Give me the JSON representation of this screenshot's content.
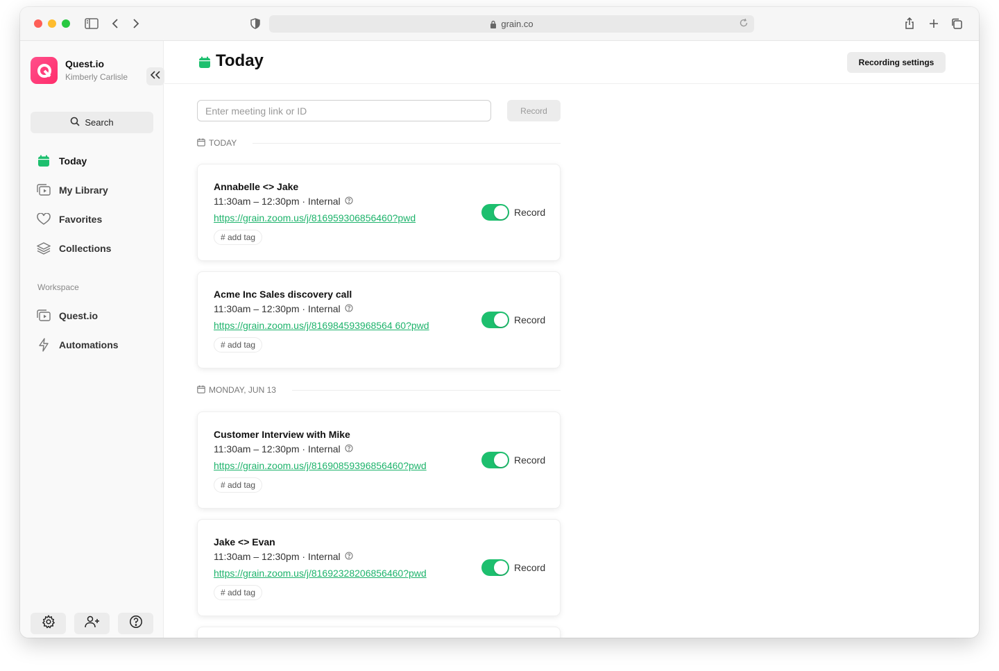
{
  "browser": {
    "url": "grain.co"
  },
  "workspace": {
    "name": "Quest.io",
    "user": "Kimberly Carlisle"
  },
  "sidebar": {
    "search_label": "Search",
    "nav": [
      {
        "label": "Today",
        "icon": "calendar-icon"
      },
      {
        "label": "My Library",
        "icon": "library-icon"
      },
      {
        "label": "Favorites",
        "icon": "heart-icon"
      },
      {
        "label": "Collections",
        "icon": "layers-icon"
      }
    ],
    "section_label": "Workspace",
    "workspace_items": [
      {
        "label": "Quest.io",
        "icon": "library-icon"
      },
      {
        "label": "Automations",
        "icon": "lightning-icon"
      }
    ]
  },
  "header": {
    "title": "Today",
    "settings_label": "Recording settings"
  },
  "meeting_bar": {
    "placeholder": "Enter meeting link or ID",
    "record_label": "Record"
  },
  "days": [
    {
      "label": "TODAY",
      "meetings": [
        {
          "title": "Annabelle <> Jake",
          "time": "11:30am – 12:30pm · Internal",
          "link": "https://grain.zoom.us/j/816959306856460?pwd",
          "tag": "# add tag",
          "record_label": "Record",
          "record_on": true
        },
        {
          "title": "Acme Inc Sales discovery call",
          "time": "11:30am – 12:30pm · Internal",
          "link": "https://grain.zoom.us/j/816984593968564 60?pwd",
          "tag": "# add tag",
          "record_label": "Record",
          "record_on": true
        }
      ]
    },
    {
      "label": "MONDAY, JUN 13",
      "meetings": [
        {
          "title": "Customer Interview with Mike",
          "time": "11:30am – 12:30pm · Internal",
          "link": "https://grain.zoom.us/j/81690859396856460?pwd",
          "tag": "# add tag",
          "record_label": "Record",
          "record_on": true
        },
        {
          "title": "Jake <> Evan",
          "time": "11:30am – 12:30pm · Internal",
          "link": "https://grain.zoom.us/j/81692328206856460?pwd",
          "tag": "# add tag",
          "record_label": "Record",
          "record_on": true
        }
      ]
    }
  ],
  "colors": {
    "accent": "#1dbf6e",
    "brand": "#ff2d6b"
  }
}
